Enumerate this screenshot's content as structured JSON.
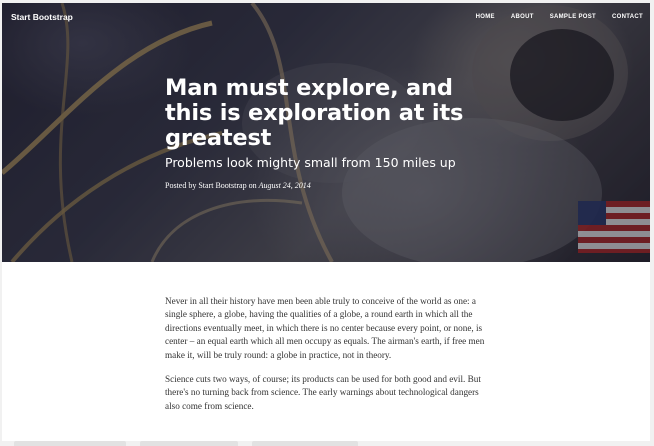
{
  "navbar": {
    "brand": "Start Bootstrap",
    "links": [
      "HOME",
      "ABOUT",
      "SAMPLE POST",
      "CONTACT"
    ]
  },
  "post": {
    "title": "Man must explore, and this is exploration at its greatest",
    "subtitle": "Problems look mighty small from 150 miles up",
    "meta_prefix": "Posted by ",
    "author": "Start Bootstrap",
    "meta_mid": " on ",
    "date": "August 24, 2014"
  },
  "body": {
    "paragraphs": [
      "Never in all their history have men been able truly to conceive of the world as one: a single sphere, a globe, having the qualities of a globe, a round earth in which all the directions eventually meet, in which there is no center because every point, or none, is center – an equal earth which all men occupy as equals. The airman's earth, if free men make it, will be truly round: a globe in practice, not in theory.",
      "Science cuts two ways, of course; its products can be used for both good and evil. But there's no turning back from science. The early warnings about technological dangers also come from science."
    ]
  },
  "colors": {
    "text": "#333333",
    "nav_text": "#ffffff",
    "page_bg": "#f1f1f1"
  }
}
